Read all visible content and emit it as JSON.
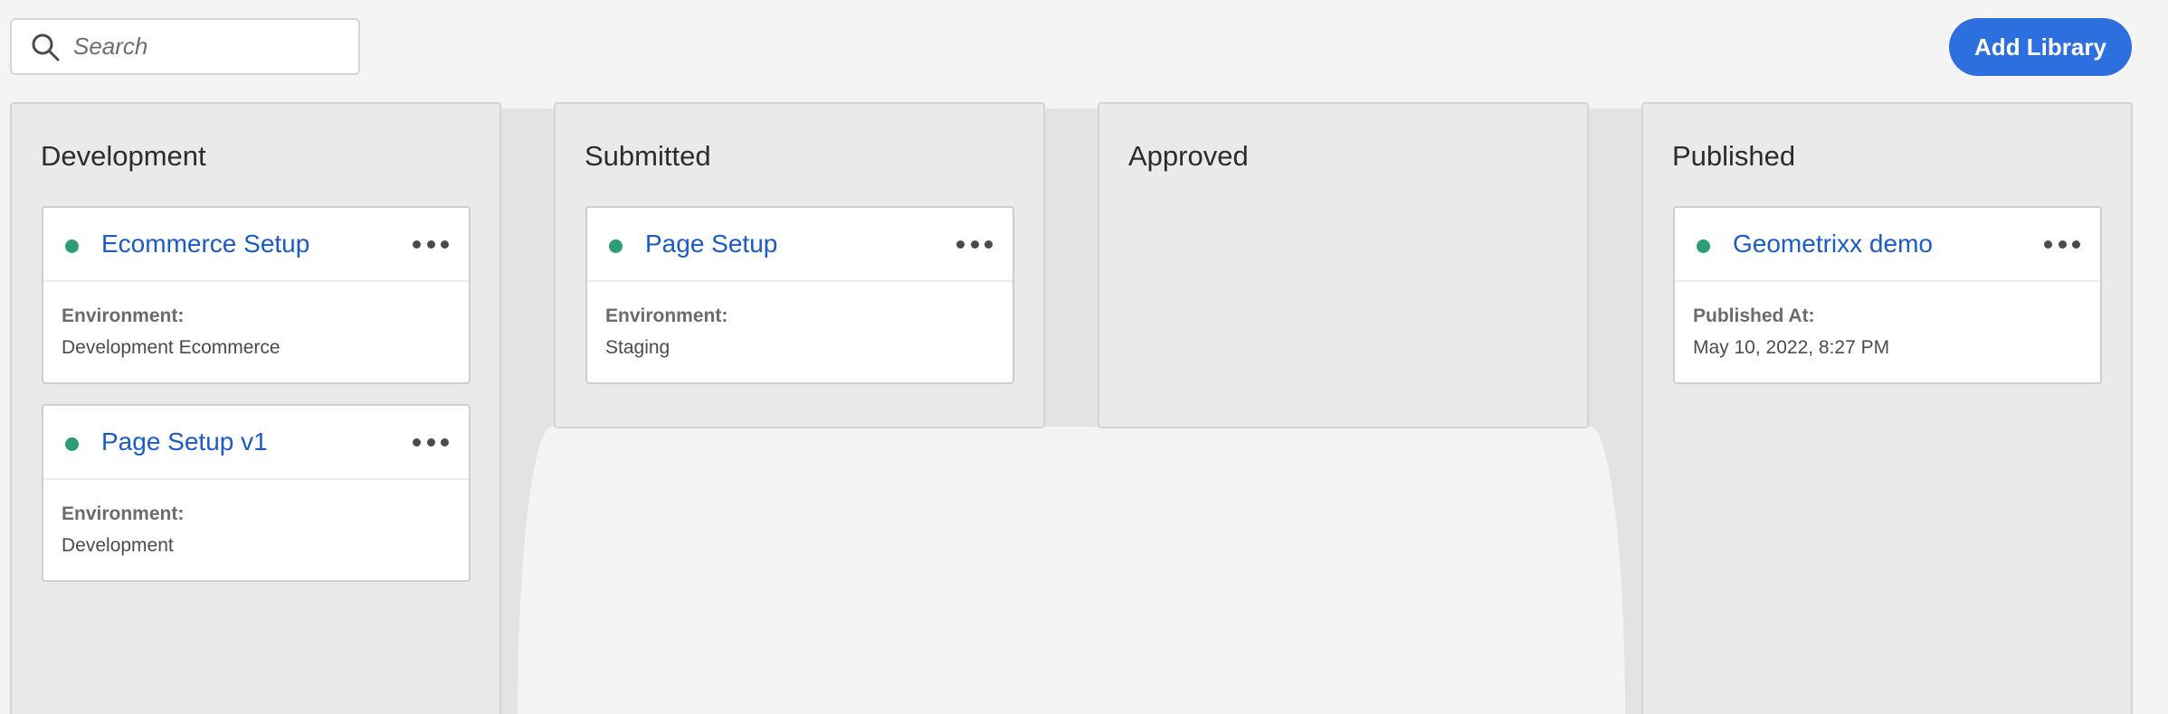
{
  "search": {
    "placeholder": "Search"
  },
  "toolbar": {
    "add_label": "Add Library"
  },
  "colors": {
    "accent": "#2d6fdf",
    "link": "#1a5bc7",
    "status_ok": "#2d9d78"
  },
  "columns": [
    {
      "title": "Development",
      "cards": [
        {
          "title": "Ecommerce Setup",
          "meta_label": "Environment:",
          "meta_value": "Development Ecommerce"
        },
        {
          "title": "Page Setup v1",
          "meta_label": "Environment:",
          "meta_value": "Development"
        }
      ]
    },
    {
      "title": "Submitted",
      "cards": [
        {
          "title": "Page Setup",
          "meta_label": "Environment:",
          "meta_value": "Staging"
        }
      ]
    },
    {
      "title": "Approved",
      "cards": []
    },
    {
      "title": "Published",
      "cards": [
        {
          "title": "Geometrixx demo",
          "meta_label": "Published At:",
          "meta_value": "May 10, 2022, 8:27 PM"
        }
      ]
    }
  ]
}
